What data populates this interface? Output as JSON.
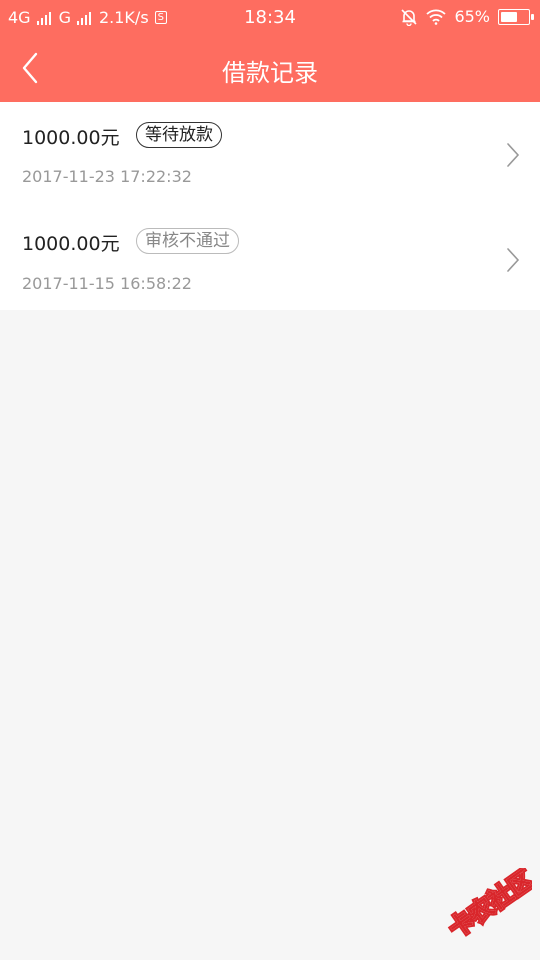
{
  "status_bar": {
    "network_1": "4G",
    "network_2": "G",
    "speed": "2.1K/s",
    "sim_label": "S",
    "time": "18:34",
    "battery": "65%",
    "battery_level": 0.65
  },
  "header": {
    "title": "借款记录",
    "background": "#fe6d60"
  },
  "records": [
    {
      "amount": "1000.00元",
      "status": "等待放款",
      "time": "2017-11-23 17:22:32"
    },
    {
      "amount": "1000.00元",
      "status": "审核不通过",
      "time": "2017-11-15 16:58:22"
    }
  ],
  "watermark": {
    "text": "卡农社区"
  }
}
